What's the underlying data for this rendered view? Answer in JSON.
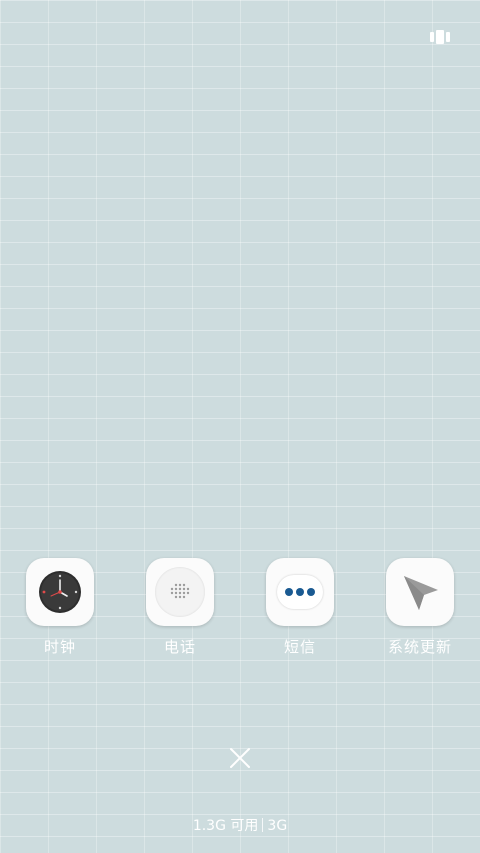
{
  "top_bar": {
    "recent_apps_icon": "recent-apps-icon"
  },
  "apps": [
    {
      "label": "时钟",
      "icon": "clock-icon"
    },
    {
      "label": "电话",
      "icon": "phone-icon"
    },
    {
      "label": "短信",
      "icon": "sms-icon"
    },
    {
      "label": "系统更新",
      "icon": "system-update-icon"
    }
  ],
  "close": {
    "icon": "close-icon"
  },
  "memory": {
    "available": "1.3G 可用",
    "total": "3G"
  },
  "colors": {
    "background": "#cddcde",
    "sms_dots": "#1a5a92",
    "clock_face": "#3a3a3a",
    "update_arrow": "#9a9a9a",
    "label_text": "#ffffff"
  }
}
